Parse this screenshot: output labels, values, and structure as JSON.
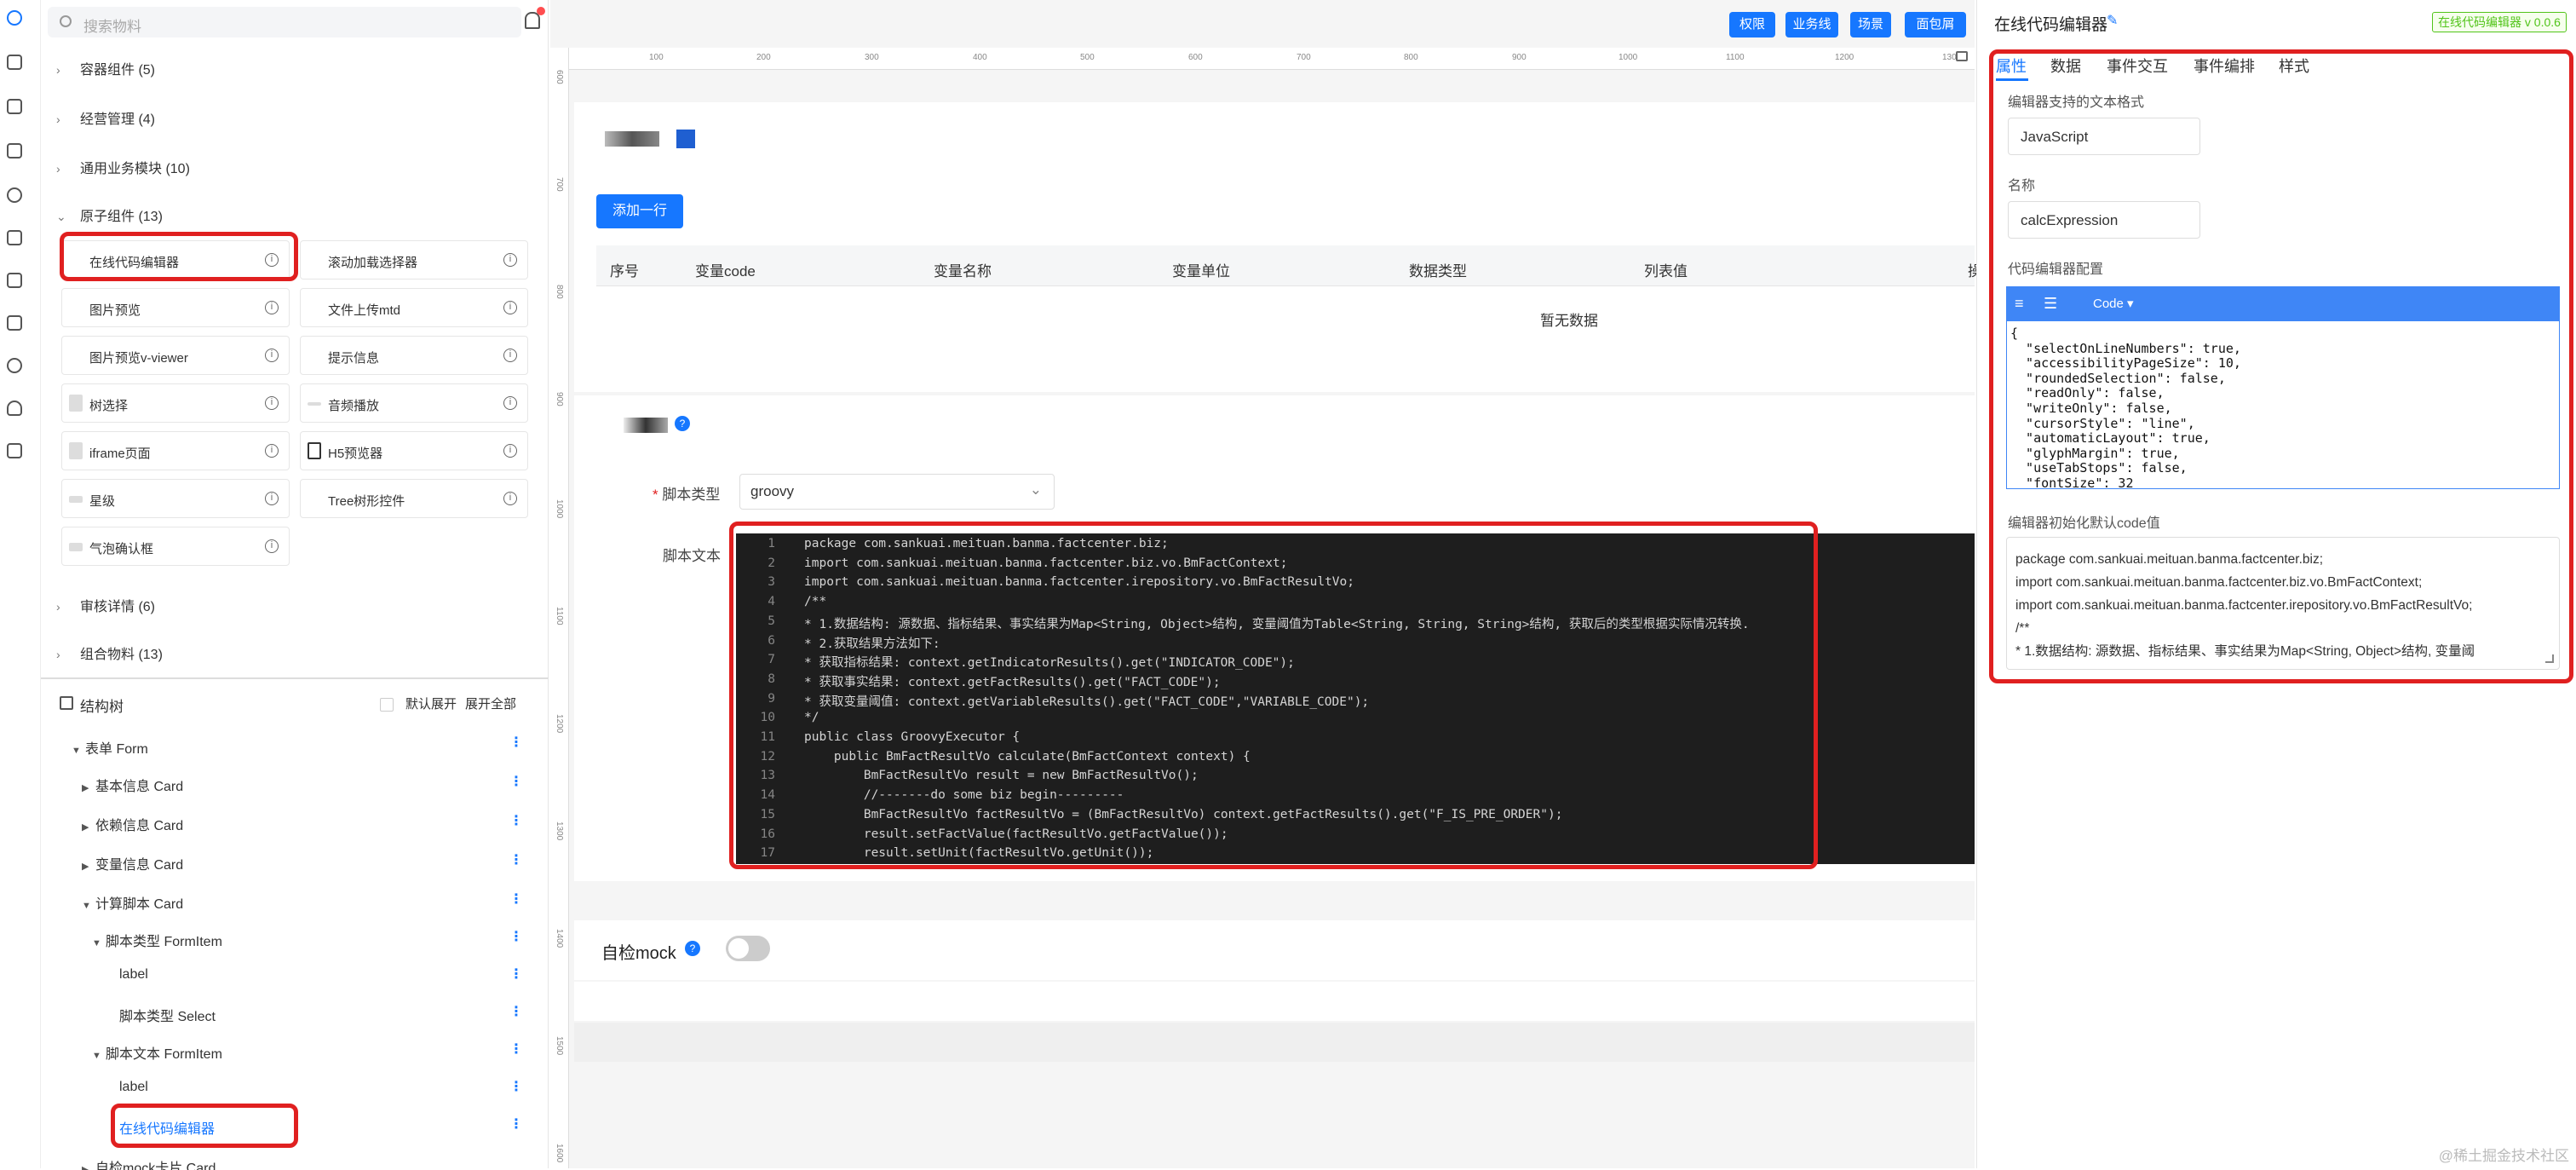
{
  "search": {
    "placeholder": "搜索物料"
  },
  "groups": [
    "容器组件 (5)",
    "经营管理 (4)",
    "通用业务模块 (10)",
    "原子组件 (13)",
    "审核详情 (6)",
    "组合物料 (13)"
  ],
  "atoms": [
    {
      "label": "在线代码编辑器"
    },
    {
      "label": "滚动加载选择器"
    },
    {
      "label": "图片预览"
    },
    {
      "label": "文件上传mtd"
    },
    {
      "label": "图片预览v-viewer"
    },
    {
      "label": "提示信息"
    },
    {
      "label": "树选择"
    },
    {
      "label": "音频播放"
    },
    {
      "label": "iframe页面"
    },
    {
      "label": "H5预览器"
    },
    {
      "label": "星级"
    },
    {
      "label": "Tree树形控件"
    },
    {
      "label": "气泡确认框"
    }
  ],
  "tree": {
    "title": "结构树",
    "default_expand": "默认展开",
    "expand_all": "展开全部",
    "nodes": [
      "表单 Form",
      "基本信息 Card",
      "依赖信息 Card",
      "变量信息 Card",
      "计算脚本 Card",
      "脚本类型 FormItem",
      "label",
      "脚本类型 Select",
      "脚本文本 FormItem",
      "label",
      "在线代码编辑器",
      "自检mock卡片 Card"
    ]
  },
  "toolbar": {
    "buttons": [
      "权限",
      "业务线",
      "场景",
      "面包屑"
    ]
  },
  "ruler": {
    "top": [
      "100",
      "200",
      "300",
      "400",
      "500",
      "600",
      "700",
      "800",
      "900",
      "1000",
      "1100",
      "1200",
      "130"
    ],
    "left": [
      "600",
      "700",
      "800",
      "900",
      "1000",
      "1100",
      "1200",
      "1300",
      "1400",
      "1500",
      "1600"
    ]
  },
  "canvas": {
    "add_row": "添加一行",
    "columns": [
      "序号",
      "变量code",
      "变量名称",
      "变量单位",
      "数据类型",
      "列表值",
      "操"
    ],
    "empty": "暂无数据",
    "script_type_label": "脚本类型",
    "script_type_value": "groovy",
    "script_text_label": "脚本文本",
    "mock_label": "自检mock"
  },
  "code_lines": [
    "package com.sankuai.meituan.banma.factcenter.biz;",
    "import com.sankuai.meituan.banma.factcenter.biz.vo.BmFactContext;",
    "import com.sankuai.meituan.banma.factcenter.irepository.vo.BmFactResultVo;",
    "/**",
    "* 1.数据结构: 源数据、指标结果、事实结果为Map<String, Object>结构, 变量阈值为Table<String, String, String>结构, 获取后的类型根据实际情况转换.",
    "* 2.获取结果方法如下:",
    "* 获取指标结果: context.getIndicatorResults().get(\"INDICATOR_CODE\");",
    "* 获取事实结果: context.getFactResults().get(\"FACT_CODE\");",
    "* 获取变量阈值: context.getVariableResults().get(\"FACT_CODE\",\"VARIABLE_CODE\");",
    "*/",
    "public class GroovyExecutor {",
    "    public BmFactResultVo calculate(BmFactContext context) {",
    "        BmFactResultVo result = new BmFactResultVo();",
    "        //-------do some biz begin---------",
    "        BmFactResultVo factResultVo = (BmFactResultVo) context.getFactResults().get(\"F_IS_PRE_ORDER\");",
    "        result.setFactValue(factResultVo.getFactValue());",
    "        result.setUnit(factResultVo.getUnit());"
  ],
  "right": {
    "title": "在线代码编辑器",
    "version": "在线代码编辑器 v 0.0.6",
    "tabs": [
      "属性",
      "数据",
      "事件交互",
      "事件编排",
      "样式"
    ],
    "format_label": "编辑器支持的文本格式",
    "format_value": "JavaScript",
    "name_label": "名称",
    "name_value": "calcExpression",
    "config_label": "代码编辑器配置",
    "config_mode": "Code",
    "config_lines": [
      "{",
      "  \"selectOnLineNumbers\": true,",
      "  \"accessibilityPageSize\": 10,",
      "  \"roundedSelection\": false,",
      "  \"readOnly\": false,",
      "  \"writeOnly\": false,",
      "  \"cursorStyle\": \"line\",",
      "  \"automaticLayout\": true,",
      "  \"glyphMargin\": true,",
      "  \"useTabStops\": false,",
      "  \"fontSize\": 32"
    ],
    "default_label": "编辑器初始化默认code值",
    "default_lines": [
      "package com.sankuai.meituan.banma.factcenter.biz;",
      "import com.sankuai.meituan.banma.factcenter.biz.vo.BmFactContext;",
      "import com.sankuai.meituan.banma.factcenter.irepository.vo.BmFactResultVo;",
      "/**",
      "* 1.数据结构: 源数据、指标结果、事实结果为Map<String, Object>结构, 变量阈"
    ]
  },
  "watermark": "@稀土掘金技术社区",
  "colors": {
    "accent": "#1677ff",
    "highlight": "#e02020",
    "editor_bg": "#1e1e1e"
  }
}
